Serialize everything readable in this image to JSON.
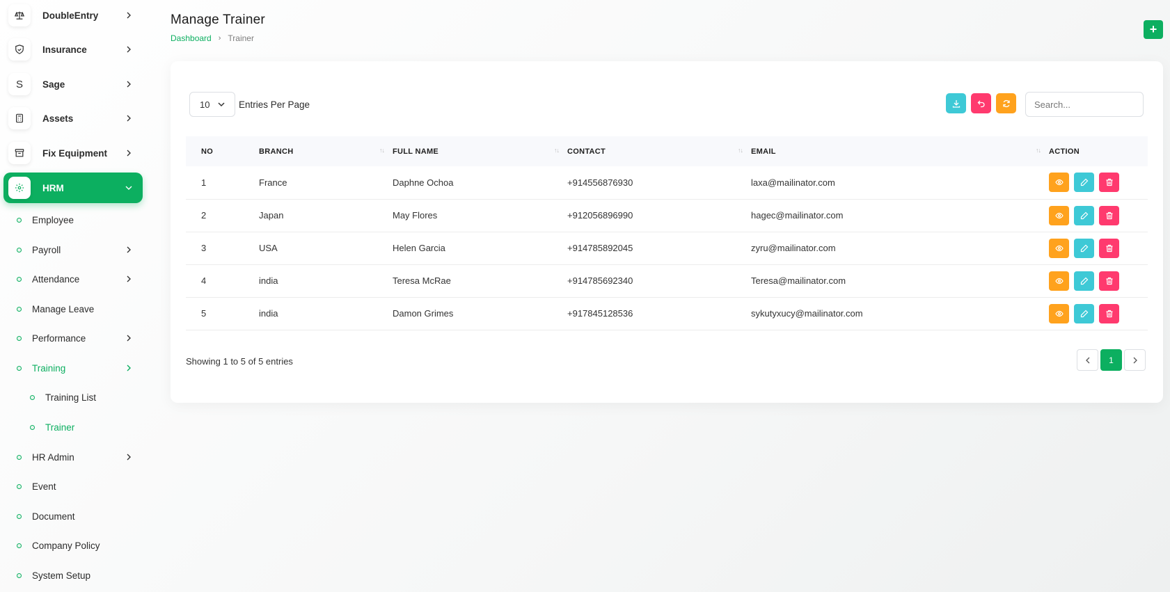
{
  "sidebar": {
    "top_items": [
      {
        "label": "DoubleEntry",
        "icon": "scale-icon"
      },
      {
        "label": "Insurance",
        "icon": "shield-icon"
      },
      {
        "label": "Sage",
        "icon": "s-letter-icon",
        "glyph": "S"
      },
      {
        "label": "Assets",
        "icon": "calculator-icon"
      },
      {
        "label": "Fix Equipment",
        "icon": "archive-icon"
      },
      {
        "label": "HRM",
        "icon": "hrm-icon",
        "active": true
      }
    ],
    "hrm_items": [
      {
        "label": "Employee"
      },
      {
        "label": "Payroll",
        "has_children": true
      },
      {
        "label": "Attendance",
        "has_children": true
      },
      {
        "label": "Manage Leave"
      },
      {
        "label": "Performance",
        "has_children": true
      },
      {
        "label": "Training",
        "has_children": true,
        "active": true
      },
      {
        "label": "Training List",
        "nested": true
      },
      {
        "label": "Trainer",
        "nested": true,
        "active": true
      },
      {
        "label": "HR Admin",
        "has_children": true
      },
      {
        "label": "Event"
      },
      {
        "label": "Document"
      },
      {
        "label": "Company Policy"
      },
      {
        "label": "System Setup"
      }
    ]
  },
  "header": {
    "title": "Manage Trainer",
    "breadcrumb": {
      "home": "Dashboard",
      "current": "Trainer"
    },
    "add_label": "+"
  },
  "toolbar": {
    "per_page_value": "10",
    "per_page_label": "Entries Per Page",
    "search_placeholder": "Search..."
  },
  "table": {
    "headers": [
      "NO",
      "BRANCH",
      "FULL NAME",
      "CONTACT",
      "EMAIL",
      "ACTION"
    ],
    "rows": [
      {
        "no": "1",
        "branch": "France",
        "name": "Daphne Ochoa",
        "contact": "+914556876930",
        "email": "laxa@mailinator.com"
      },
      {
        "no": "2",
        "branch": "Japan",
        "name": "May Flores",
        "contact": "+912056896990",
        "email": "hagec@mailinator.com"
      },
      {
        "no": "3",
        "branch": "USA",
        "name": "Helen Garcia",
        "contact": "+914785892045",
        "email": "zyru@mailinator.com"
      },
      {
        "no": "4",
        "branch": "india",
        "name": "Teresa McRae",
        "contact": "+914785692340",
        "email": "Teresa@mailinator.com"
      },
      {
        "no": "5",
        "branch": "india",
        "name": "Damon Grimes",
        "contact": "+917845128536",
        "email": "sykutyxucy@mailinator.com"
      }
    ]
  },
  "footer": {
    "showing": "Showing 1 to 5 of 5 entries",
    "current_page": "1"
  },
  "colors": {
    "primary": "#0caf60",
    "info": "#3ec9d6",
    "danger": "#ff3a6e",
    "warning": "#ffa21d"
  }
}
